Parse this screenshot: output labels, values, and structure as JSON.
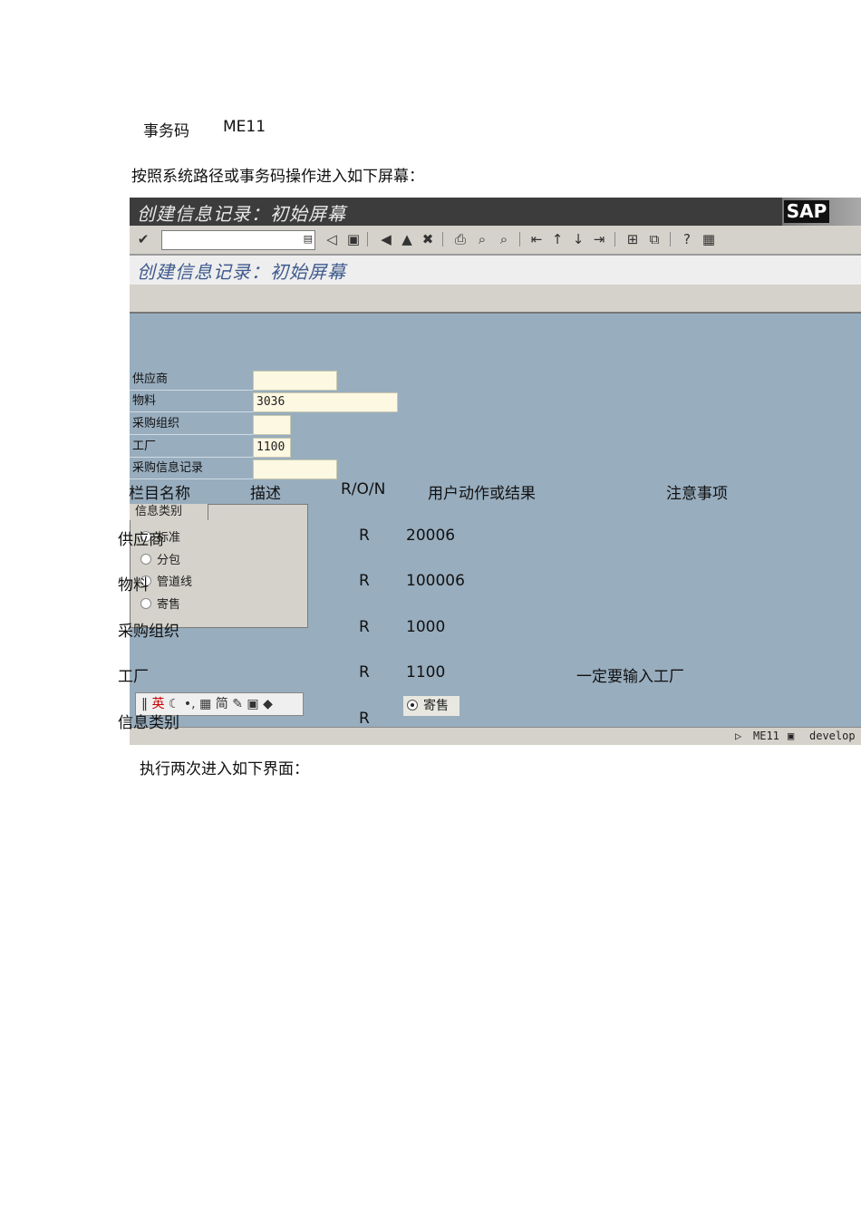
{
  "intro": {
    "tcode_label": "事务码",
    "tcode_value": "ME11",
    "instruction": "按照系统路径或事务码操作进入如下屏幕："
  },
  "sap_window": {
    "title": "创建信息记录：初始屏幕",
    "logo": "SAP",
    "screen_title": "创建信息记录：初始屏幕",
    "fields": [
      {
        "label": "供应商",
        "value": ""
      },
      {
        "label": "物料",
        "value": "3036"
      },
      {
        "label": "采购组织",
        "value": ""
      },
      {
        "label": "工厂",
        "value": "1100"
      },
      {
        "label": "采购信息记录",
        "value": ""
      }
    ],
    "info_category": {
      "title": "信息类别",
      "options": [
        "标准",
        "分包",
        "管道线",
        "寄售"
      ]
    },
    "ime_bar": {
      "mode": "英",
      "script": "简"
    },
    "selected_option": "寄售",
    "statusbar": {
      "tcode": "ME11",
      "system": "develop"
    }
  },
  "table": {
    "headers": [
      "栏目名称",
      "描述",
      "R/O/N",
      "用户动作或结果",
      "注意事项"
    ],
    "rows": [
      {
        "name": "供应商",
        "ron": "R",
        "action": "20006",
        "note": ""
      },
      {
        "name": "物料",
        "ron": "R",
        "action": "100006",
        "note": ""
      },
      {
        "name": "采购组织",
        "ron": "R",
        "action": "1000",
        "note": ""
      },
      {
        "name": "工厂",
        "ron": "R",
        "action": "1100",
        "note": "一定要输入工厂"
      },
      {
        "name": "信息类别",
        "ron": "R",
        "action": "",
        "note": ""
      }
    ]
  },
  "footer": {
    "text": "执行两次进入如下界面："
  }
}
